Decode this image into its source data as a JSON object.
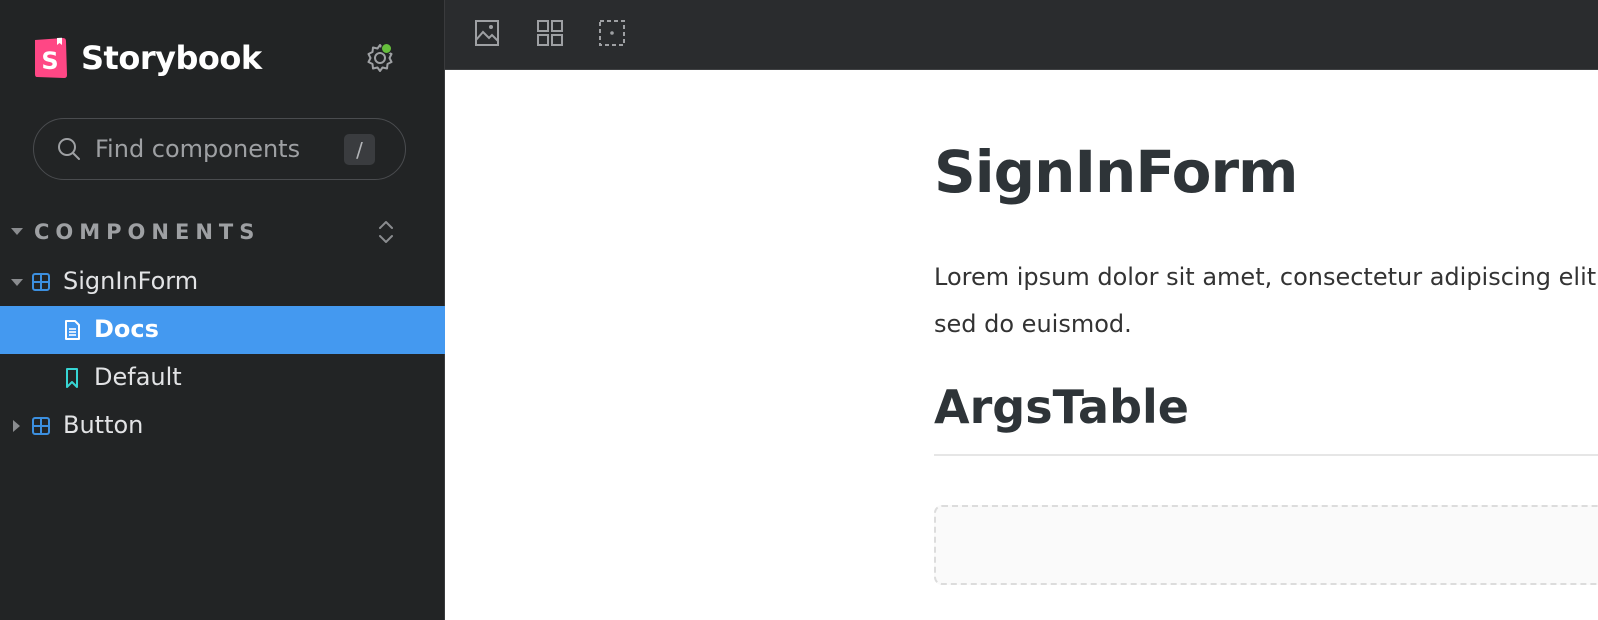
{
  "brand": {
    "name": "Storybook",
    "logo_letter": "S"
  },
  "search": {
    "placeholder": "Find components",
    "shortcut": "/"
  },
  "section": {
    "label": "COMPONENTS"
  },
  "tree": {
    "items": [
      {
        "label": "SignInForm",
        "type": "component",
        "expanded": true
      },
      {
        "label": "Docs",
        "type": "docs",
        "selected": true
      },
      {
        "label": "Default",
        "type": "story"
      },
      {
        "label": "Button",
        "type": "component",
        "expanded": false
      }
    ]
  },
  "toolbar": {
    "tools": [
      "image-icon",
      "grid-icon",
      "outline-icon"
    ]
  },
  "doc": {
    "title": "SignInForm",
    "description": "Lorem ipsum dolor sit amet, consectetur adipiscing elit, sed do euismod.",
    "args_heading": "ArgsTable"
  },
  "colors": {
    "sidebar_bg": "#222425",
    "selected_bg": "#4499f0",
    "brand_pink": "#ff4785",
    "component_icon": "#3c8fdf",
    "story_icon": "#37d5d3",
    "status_dot": "#66bf3c"
  }
}
